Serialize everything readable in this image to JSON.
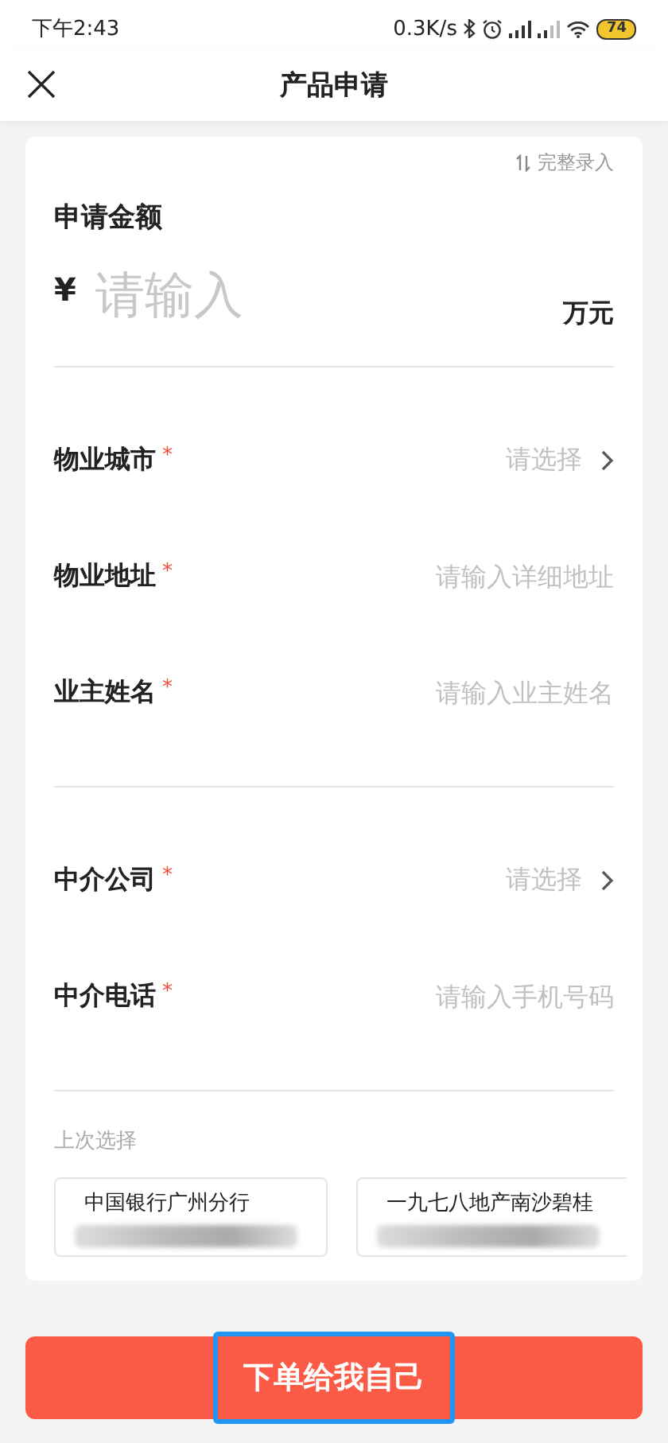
{
  "status_bar": {
    "time": "下午2:43",
    "speed": "0.3K/s",
    "battery": "74"
  },
  "nav": {
    "title": "产品申请"
  },
  "amount": {
    "switch_label": "完整录入",
    "label": "申请金额",
    "currency": "¥",
    "placeholder": "请输入",
    "unit": "万元"
  },
  "groups": [
    {
      "fields": [
        {
          "kind": "select",
          "label": "物业城市",
          "mark": "*",
          "placeholder": "请选择"
        },
        {
          "kind": "text",
          "label": "物业地址",
          "mark": "*",
          "placeholder": "请输入详细地址"
        },
        {
          "kind": "text",
          "label": "业主姓名",
          "mark": "*",
          "placeholder": "请输入业主姓名"
        }
      ]
    },
    {
      "fields": [
        {
          "kind": "select",
          "label": "中介公司",
          "mark": "*",
          "placeholder": "请选择"
        },
        {
          "kind": "text",
          "label": "中介电话",
          "mark": "*",
          "placeholder": "请输入手机号码"
        }
      ]
    }
  ],
  "recent": {
    "title": "上次选择",
    "items": [
      {
        "name": "中国银行广州分行"
      },
      {
        "name": "一九七八地产南沙碧桂"
      }
    ]
  },
  "submit": {
    "label": "下单给我自己",
    "focused": true
  }
}
